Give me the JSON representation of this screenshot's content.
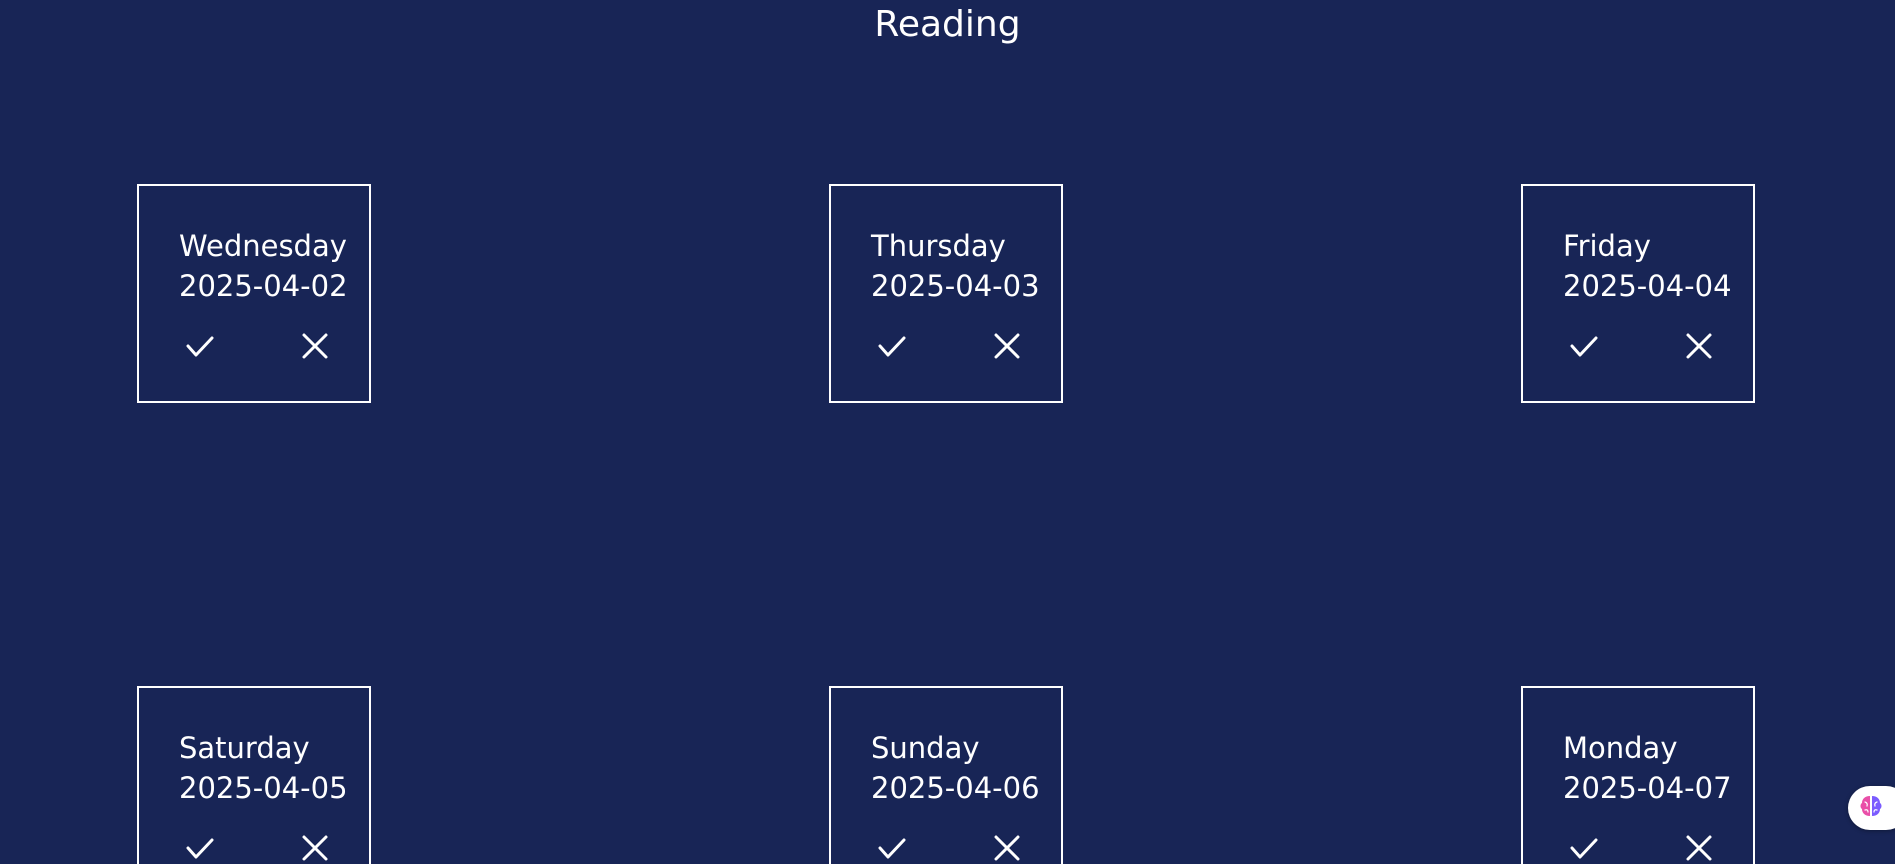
{
  "header": {
    "title": "Reading"
  },
  "days": [
    {
      "day": "Wednesday",
      "date": "2025-04-02"
    },
    {
      "day": "Thursday",
      "date": "2025-04-03"
    },
    {
      "day": "Friday",
      "date": "2025-04-04"
    },
    {
      "day": "Saturday",
      "date": "2025-04-05"
    },
    {
      "day": "Sunday",
      "date": "2025-04-06"
    },
    {
      "day": "Monday",
      "date": "2025-04-07"
    }
  ],
  "icons": {
    "done": "check-icon",
    "missed": "close-icon",
    "widget": "brain-icon"
  },
  "colors": {
    "background": "#182556",
    "foreground": "#ffffff",
    "widget_accent_pink": "#e94fa8",
    "widget_accent_purple": "#7b5cff"
  }
}
